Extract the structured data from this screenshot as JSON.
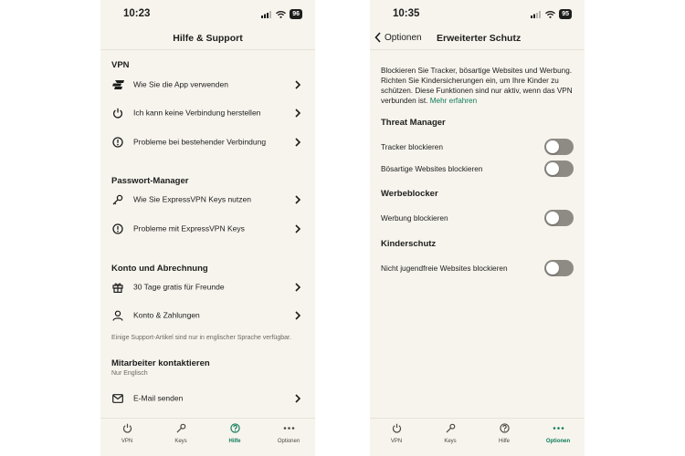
{
  "left": {
    "status": {
      "time": "10:23",
      "battery": "96"
    },
    "title": "Hilfe & Support",
    "vpn": {
      "heading": "VPN",
      "items": [
        {
          "icon": "expressvpn-logo-icon",
          "label": "Wie Sie die App verwenden"
        },
        {
          "icon": "power-icon",
          "label": "Ich kann keine Verbindung herstellen"
        },
        {
          "icon": "alert-circle-icon",
          "label": "Probleme bei bestehender Verbindung"
        }
      ]
    },
    "passwords": {
      "heading": "Passwort-Manager",
      "items": [
        {
          "icon": "key-icon",
          "label": "Wie Sie ExpressVPN Keys nutzen"
        },
        {
          "icon": "alert-circle-icon",
          "label": "Probleme mit ExpressVPN Keys"
        }
      ]
    },
    "account": {
      "heading": "Konto und Abrechnung",
      "items": [
        {
          "icon": "gift-icon",
          "label": "30 Tage gratis für Freunde"
        },
        {
          "icon": "person-icon",
          "label": "Konto & Zahlungen"
        }
      ]
    },
    "note": "Einige Support-Artikel sind nur in englischer Sprache verfügbar.",
    "contact": {
      "heading": "Mitarbeiter kontaktieren",
      "sub": "Nur Englisch",
      "email_label": "E-Mail senden"
    },
    "tabs": [
      "VPN",
      "Keys",
      "Hilfe",
      "Optionen"
    ],
    "active_tab": "Hilfe"
  },
  "right": {
    "status": {
      "time": "10:35",
      "battery": "95"
    },
    "back_label": "Optionen",
    "title": "Erweiterter Schutz",
    "description": "Blockieren Sie Tracker, bösartige Websites und Werbung. Richten Sie Kindersicherungen ein, um Ihre Kinder zu schützen. Diese Funktionen sind nur aktiv, wenn das VPN verbunden ist.",
    "more_link": "Mehr erfahren",
    "threat": {
      "heading": "Threat Manager",
      "toggles": [
        {
          "label": "Tracker blockieren",
          "on": false
        },
        {
          "label": "Bösartige Websites blockieren",
          "on": false
        }
      ]
    },
    "ads": {
      "heading": "Werbeblocker",
      "toggles": [
        {
          "label": "Werbung blockieren",
          "on": false
        }
      ]
    },
    "kids": {
      "heading": "Kinderschutz",
      "toggles": [
        {
          "label": "Nicht jugendfreie Websites blockieren",
          "on": false
        }
      ]
    },
    "tabs": [
      "VPN",
      "Keys",
      "Hilfe",
      "Optionen"
    ],
    "active_tab": "Optionen"
  },
  "colors": {
    "accent": "#0e7c59",
    "background": "#f7f4ee",
    "toggle_off": "#8e8a84"
  }
}
